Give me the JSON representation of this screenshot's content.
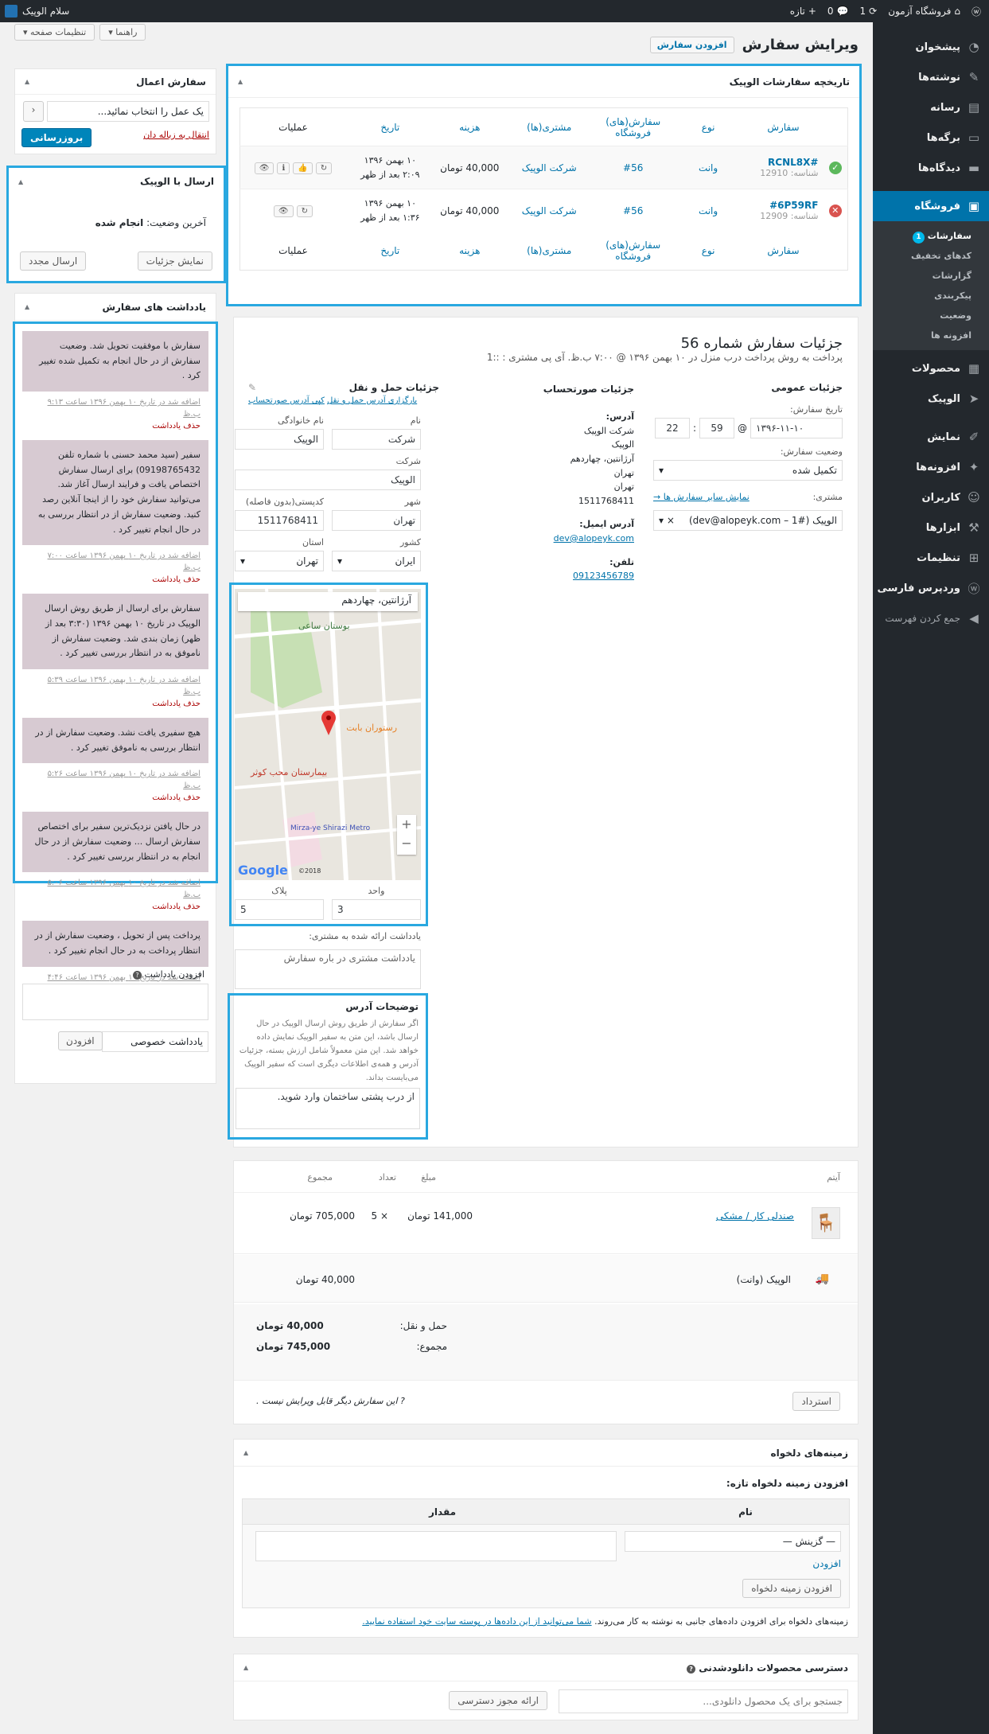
{
  "adminbar": {
    "site_name": "فروشگاه آزمون",
    "updates": "1",
    "comments": "0",
    "new_label": "تازه",
    "greeting": "سلام الوپیک"
  },
  "sidebar": {
    "items": [
      {
        "label": "پیشخوان",
        "icon": "dashboard-icon"
      },
      {
        "label": "نوشته‌ها",
        "icon": "pin-icon"
      },
      {
        "label": "رسانه",
        "icon": "media-icon"
      },
      {
        "label": "برگه‌ها",
        "icon": "page-icon"
      },
      {
        "label": "دیدگاه‌ها",
        "icon": "comment-icon"
      }
    ],
    "shop_label": "فروشگاه",
    "shop_sub": [
      "سفارشات",
      "کدهای تخفیف",
      "گزارشات",
      "پیکربندی",
      "وضعیت",
      "افزونه ها"
    ],
    "orders_badge": "1",
    "items2": [
      {
        "label": "محصولات",
        "icon": "box-icon"
      },
      {
        "label": "الوپیک",
        "icon": "alopeyk-icon"
      }
    ],
    "items3": [
      {
        "label": "نمایش",
        "icon": "brush-icon"
      },
      {
        "label": "افزونه‌ها",
        "icon": "plugin-icon"
      },
      {
        "label": "کاربران",
        "icon": "users-icon"
      },
      {
        "label": "ابزارها",
        "icon": "tools-icon"
      },
      {
        "label": "تنظیمات",
        "icon": "settings-icon"
      },
      {
        "label": "وردپرس فارسی",
        "icon": "wp-fa-icon"
      },
      {
        "label": "جمع کردن فهرست",
        "icon": "collapse-icon"
      }
    ]
  },
  "top": {
    "screen_options": "تنظیمات صفحه",
    "help": "راهنما",
    "page_title": "ویرایش سفارش",
    "add_order": "افزودن سفارش"
  },
  "history": {
    "title": "تاریخچه سفارشات الوپیک",
    "headers": [
      "سفارش",
      "نوع",
      "سفارش(های) فروشگاه",
      "مشتری(ها)",
      "هزینه",
      "تاریخ",
      "عملیات"
    ],
    "rows": [
      {
        "code": "#RCNL8X",
        "id": "شناسه: 12910",
        "type": "وانت",
        "order": "#56",
        "customer": "شرکت الوپیک",
        "cost": "40,000 تومان",
        "date": "۱۰ بهمن ۱۳۹۶",
        "time": "۲:۰۹ بعد از ظهر",
        "status": "success"
      },
      {
        "code": "#6P59RF",
        "id": "شناسه: 12909",
        "type": "وانت",
        "order": "#56",
        "customer": "شرکت الوپیک",
        "cost": "40,000 تومان",
        "date": "۱۰ بهمن ۱۳۹۶",
        "time": "۱:۳۶ بعد از ظهر",
        "status": "failed"
      }
    ]
  },
  "order_actions": {
    "title": "سفارش اعمال",
    "select": "یک عمل را انتخاب نمائید...",
    "trash": "انتقال به زباله دان",
    "update": "بروزرسانی"
  },
  "send": {
    "title": "ارسال با الوپیک",
    "last_status_label": "آخرین وضعیت:",
    "last_status": "انجام شده",
    "details": "نمایش جزئیات",
    "resend": "ارسال مجدد"
  },
  "notes": {
    "title": "یادداشت های سفارش",
    "items": [
      {
        "text": "سفارش با موفقیت تحویل شد. وضعیت سفارش از در حال انجام به تکمیل شده تغییر کرد .",
        "meta": "اضافه شد در تاریخ ۱۰ بهمن ۱۳۹۶ ساعت ۹:۱۳ ب.ظ"
      },
      {
        "text": "سفیر (سید محمد حسنی با شماره تلفن 09198765432) برای ارسال سفارش اختصاص یافت و فرایند ارسال آغاز شد. می‌توانید سفارش خود را از اینجا آنلاین رصد کنید. وضعیت سفارش از در انتظار بررسی به در حال انجام تغییر کرد .",
        "meta": "اضافه شد در تاریخ ۱۰ بهمن ۱۳۹۶ ساعت ۷:۰۰ ب.ظ"
      },
      {
        "text": "سفارش برای ارسال از طریق روش ارسال الوپیک در تاریخ ۱۰ بهمن ۱۳۹۶ (۳:۳۰ بعد از ظهر) زمان بندی شد. وضعیت سفارش از ناموفق به در انتظار بررسی تغییر کرد .",
        "meta": "اضافه شد در تاریخ ۱۰ بهمن ۱۳۹۶ ساعت ۵:۳۹ ب.ظ"
      },
      {
        "text": "هیچ سفیری یافت نشد. وضعیت سفارش از در انتظار بررسی به ناموفق تغییر کرد .",
        "meta": "اضافه شد در تاریخ ۱۰ بهمن ۱۳۹۶ ساعت ۵:۲۶ ب.ظ"
      },
      {
        "text": "در حال یافتن نزدیک‌ترین سفیر برای اختصاص سفارش ارسال ... وضعیت سفارش از در حال انجام به در انتظار بررسی تغییر کرد .",
        "meta": "اضافه شد در تاریخ ۱۰ بهمن ۱۳۹۶ ساعت ۵:۰۶ ب.ظ"
      },
      {
        "text": "پرداخت پس از تحویل ، وضعیت سفارش از در انتظار پرداخت به در حال انجام تغییر کرد .",
        "meta": "اضافه شد در تاریخ ۱۰ بهمن ۱۳۹۶ ساعت ۴:۴۶ ب.ظ"
      }
    ],
    "delete": "حذف یادداشت",
    "add_label": "افزودن یادداشت",
    "type": "یادداشت خصوصی",
    "add_btn": "افزودن"
  },
  "details": {
    "title": "جزئیات سفارش شماره 56",
    "subtitle": "پرداخت به روش پرداخت درب منزل در ۱۰ بهمن ۱۳۹۶ @ ۷:۰۰ ب.ظ. آی پی مشتری : ::1",
    "general": {
      "title": "جزئیات عمومی",
      "date_label": "تاریخ سفارش:",
      "date": "۱۳۹۶-۱۱-۱۰",
      "hour": "22",
      "minute": "59",
      "status_label": "وضعیت سفارش:",
      "status": "تکمیل شده",
      "customer_label": "مشتری:",
      "other_orders": "نمایش سایر سفارش ها →",
      "customer": "الوپیک (#1 – dev@alopeyk.com)"
    },
    "billing": {
      "title": "جزئیات صورتحساب",
      "address_label": "آدرس:",
      "address": [
        "شرکت الوپیک",
        "الوپیک",
        "آرژانتین، چهاردهم",
        "تهران",
        "تهران",
        "1511768411"
      ],
      "email_label": "آدرس ایمیل:",
      "email": "dev@alopeyk.com",
      "phone_label": "تلفن:",
      "phone": "09123456789"
    },
    "shipping": {
      "title": "جزئیات حمل و نقل",
      "load": "بارگزاری آدرس حمل و نقل",
      "copy": "کپی آدرس صورتحساب",
      "fname_label": "نام",
      "fname": "شرکت",
      "lname_label": "نام خانوادگی",
      "lname": "الوپیک",
      "company_label": "شرکت",
      "company": "الوپیک",
      "city_label": "شهر",
      "city": "تهران",
      "postcode_label": "کدپستی(بدون فاصله)",
      "postcode": "1511768411",
      "country_label": "کشور",
      "country": "ایران",
      "state_label": "استان",
      "state": "تهران",
      "map_search": "آرژانتین، چهاردهم",
      "map_labels": [
        "بوستان ساعی",
        "رستوران بابت",
        "بیمارستان محب کوثر",
        "Mirza-ye Shirazi Metro",
        "Google",
        "2018©"
      ],
      "unit_label": "واحد",
      "unit": "3",
      "plaque_label": "پلاک",
      "plaque": "5",
      "note_label": "یادداشت ارائه شده به مشتری:",
      "note_placeholder": "یادداشت مشتری در باره سفارش",
      "addr_desc_title": "توضیحات آدرس",
      "addr_desc_help": "اگر سفارش از طریق روش ارسال الوپیک در حال ارسال باشد، این متن به سفیر الوپیک نمایش داده خواهد شد. این متن معمولاً شامل ارزش بسته، جزئیات آدرس و همه‌ی اطلاعات دیگری است که سفیر الوپیک می‌بایست بداند.",
      "addr_desc_value": "از درب پشتی ساختمان وارد شوید."
    }
  },
  "items": {
    "headers": [
      "آیتم",
      "مبلغ",
      "تعداد",
      "مجموع"
    ],
    "product": {
      "name": "صندلی کار / مشکی",
      "price": "141,000 تومان",
      "qty": "5",
      "total": "705,000 تومان"
    },
    "shipping": {
      "name": "الوپیک (وانت)",
      "total": "40,000 تومان"
    },
    "totals": [
      {
        "label": "حمل و نقل:",
        "value": "40,000 تومان"
      },
      {
        "label": "مجموع:",
        "value": "745,000 تومان"
      }
    ],
    "refund": "استرداد",
    "not_editable": "این سفارش دیگر قابل ویرایش نیست ."
  },
  "custom_fields": {
    "title": "زمینه‌های دلخواه",
    "add_new": "افزودن زمینه دلخواه تازه:",
    "name_header": "نام",
    "value_header": "مقدار",
    "select": "— گزینش —",
    "enter_new": "افزودن",
    "add_btn": "افزودن زمینه دلخواه",
    "footer": "زمینه‌های دلخواه برای افزودن داده‌های جانبی به نوشته به کار می‌روند.",
    "footer_link": "شما می‌توانید از این داده‌ها در پوسته سایت خود استفاده نمایید."
  },
  "downloads": {
    "title": "دسترسی محصولات دانلودشدنی",
    "search": "جستجو برای یک محصول دانلودی...",
    "grant": "ارائه مجوز دسترسی"
  }
}
